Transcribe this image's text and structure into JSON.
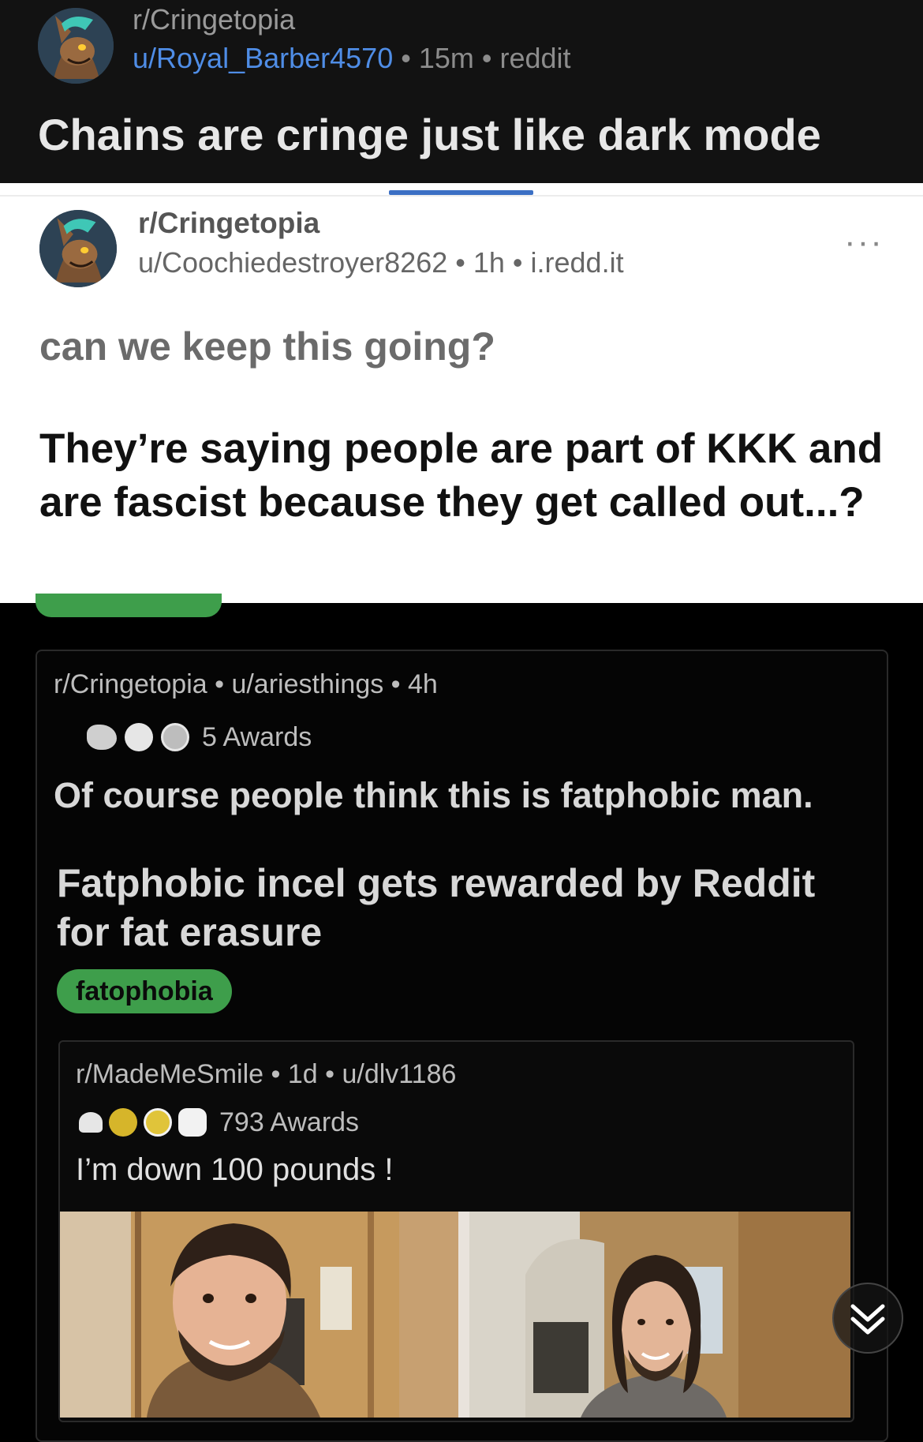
{
  "header": {
    "subreddit": "r/Cringetopia",
    "user": "u/Royal_Barber4570",
    "meta_rest": " • 15m • reddit",
    "title": "Chains are cringe just like dark mode"
  },
  "card": {
    "subreddit": "r/Cringetopia",
    "meta": "u/Coochiedestroyer8262 • 1h • i.redd.it",
    "more": "···",
    "question": "can we keep this going?",
    "body": "They’re saying people are part of KKK and are fascist because they get called out...?"
  },
  "inner1": {
    "meta": "r/Cringetopia • u/ariesthings • 4h",
    "awards": "5 Awards",
    "line1": "Of course people think this is fatphobic man.",
    "title": "Fatphobic incel gets rewarded by Reddit for fat erasure",
    "flair": "fatophobia"
  },
  "inner2": {
    "meta": "r/MadeMeSmile • 1d • u/dlv1186",
    "awards": "793 Awards",
    "text": "I’m down 100 pounds !"
  },
  "icons": {
    "avatar": "furry-avatar-icon",
    "more": "more-options-icon",
    "scroll": "double-chevron-down-icon"
  },
  "colors": {
    "link": "#4f8de6",
    "flair": "#3e9e4b",
    "dark_bg": "#121212"
  }
}
